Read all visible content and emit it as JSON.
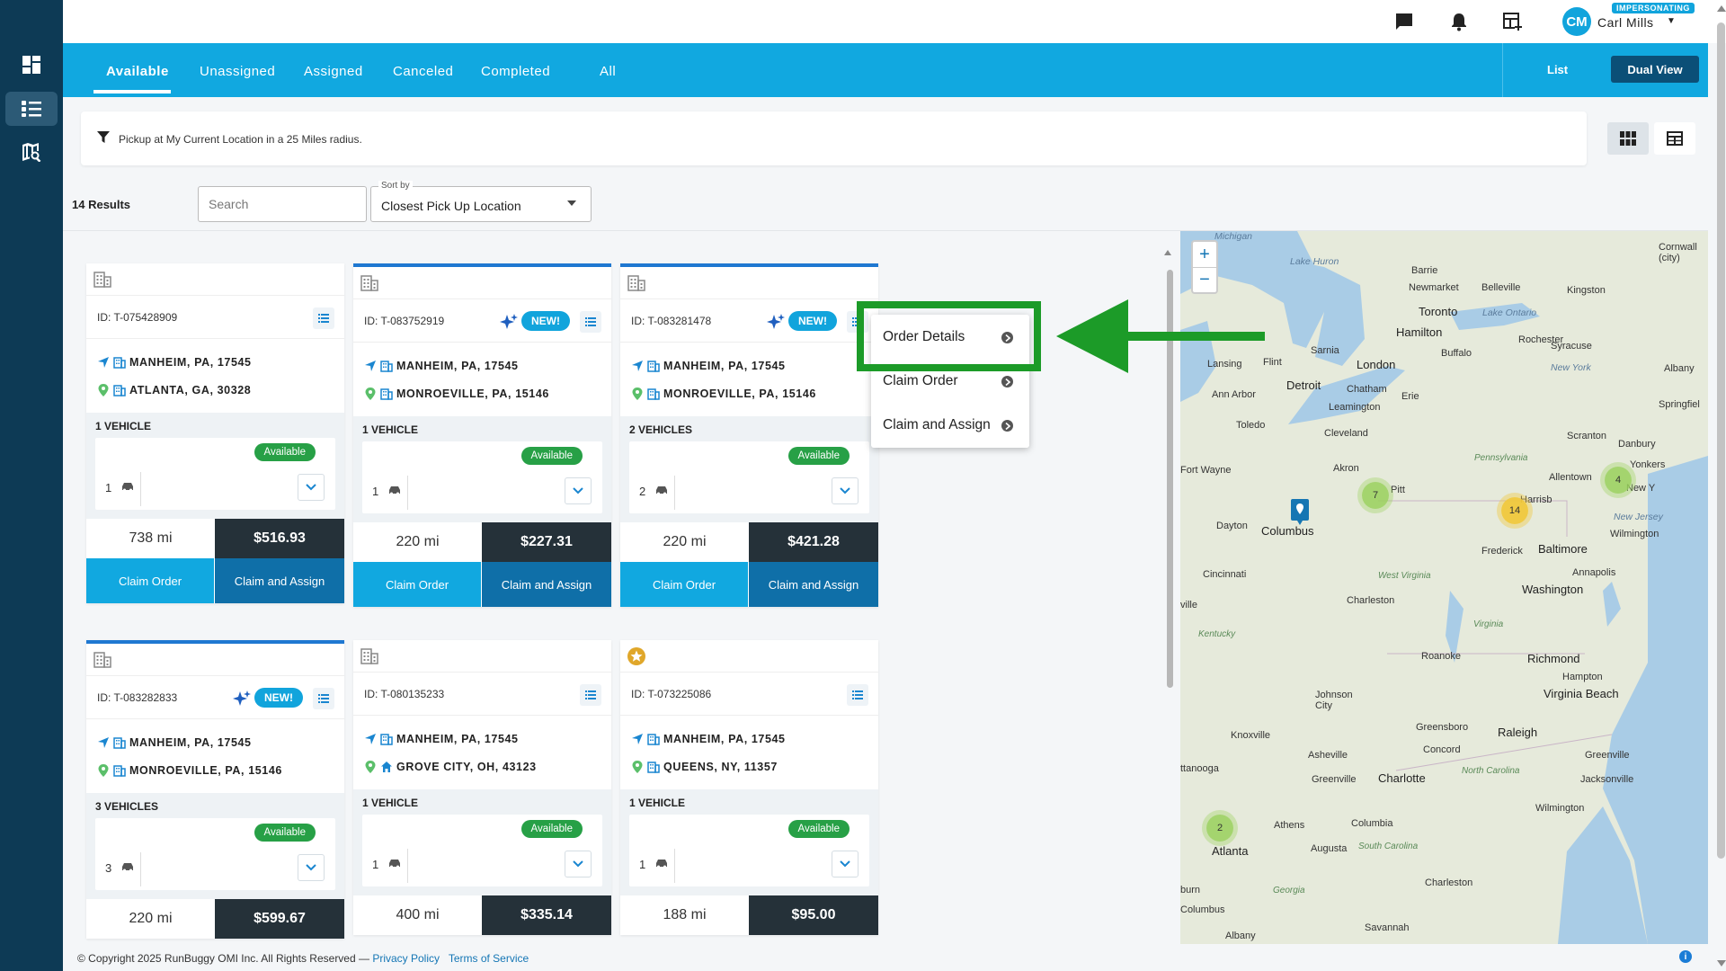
{
  "header": {
    "avatar_initials": "CM",
    "impersonating_label": "IMPERSONATING",
    "user_name": "Carl Mills"
  },
  "tabs": [
    {
      "label": "Available",
      "active": true
    },
    {
      "label": "Unassigned"
    },
    {
      "label": "Assigned"
    },
    {
      "label": "Canceled"
    },
    {
      "label": "Completed"
    },
    {
      "label": "All"
    }
  ],
  "view_toggle": {
    "list_label": "List",
    "dual_label": "Dual View"
  },
  "filter": {
    "text": "Pickup at My Current Location in a 25 Miles radius."
  },
  "toolbar": {
    "results": "14 Results",
    "search_placeholder": "Search",
    "sort_label": "Sort by",
    "sort_value": "Closest Pick Up Location"
  },
  "orders": [
    {
      "id": "ID: T-075428909",
      "new": false,
      "origin": "MANHEIM, PA, 17545",
      "destination": "ATLANTA, GA, 30328",
      "vehicles_label": "1 VEHICLE",
      "count": "1",
      "status": "Available",
      "miles": "738 mi",
      "price": "$516.93",
      "claim": "Claim Order",
      "assign": "Claim and Assign"
    },
    {
      "id": "ID: T-083752919",
      "new": true,
      "new_label": "NEW!",
      "origin": "MANHEIM, PA, 17545",
      "destination": "MONROEVILLE, PA, 15146",
      "vehicles_label": "1 VEHICLE",
      "count": "1",
      "status": "Available",
      "miles": "220 mi",
      "price": "$227.31",
      "claim": "Claim Order",
      "assign": "Claim and Assign"
    },
    {
      "id": "ID: T-083281478",
      "new": true,
      "new_label": "NEW!",
      "origin": "MANHEIM, PA, 17545",
      "destination": "MONROEVILLE, PA, 15146",
      "vehicles_label": "2 VEHICLES",
      "count": "2",
      "status": "Available",
      "miles": "220 mi",
      "price": "$421.28",
      "claim": "Claim Order",
      "assign": "Claim and Assign"
    },
    {
      "id": "ID: T-083282833",
      "new": true,
      "new_label": "NEW!",
      "origin": "MANHEIM, PA, 17545",
      "destination": "MONROEVILLE, PA, 15146",
      "vehicles_label": "3 VEHICLES",
      "count": "3",
      "status": "Available",
      "miles": "220 mi",
      "price": "$599.67"
    },
    {
      "id": "ID: T-080135233",
      "new": false,
      "origin": "MANHEIM, PA, 17545",
      "destination": "GROVE CITY, OH, 43123",
      "vehicles_label": "1 VEHICLE",
      "count": "1",
      "status": "Available",
      "miles": "400 mi",
      "price": "$335.14"
    },
    {
      "id": "ID: T-073225086",
      "new": false,
      "origin": "MANHEIM, PA, 17545",
      "destination": "QUEENS, NY, 11357",
      "vehicles_label": "1 VEHICLE",
      "count": "1",
      "status": "Available",
      "miles": "188 mi",
      "price": "$95.00"
    }
  ],
  "context_menu": [
    "Order Details",
    "Claim Order",
    "Claim and Assign"
  ],
  "map": {
    "clusters": [
      {
        "label": "7",
        "color": "green"
      },
      {
        "label": "14",
        "color": "yellow"
      },
      {
        "label": "4",
        "color": "green"
      },
      {
        "label": "2",
        "color": "green"
      }
    ],
    "labels": [
      "Michigan",
      "Lake Huron",
      "Cornwall (city)",
      "Barrie",
      "Newmarket",
      "Belleville",
      "Kingston",
      "Toronto",
      "Lake Ontario",
      "Hamilton",
      "Rochester",
      "Syracuse",
      "Buffalo",
      "New York",
      "Albany",
      "Sarnia",
      "London",
      "Lansing",
      "Flint",
      "Detroit",
      "Chatham",
      "Ann Arbor",
      "Erie",
      "Leamington",
      "Springfiel",
      "Toledo",
      "Cleveland",
      "Scranton",
      "Danbury",
      "Pennsylvania",
      "Akron",
      "Allentown",
      "Yonkers",
      "Fort Wayne",
      "Pitt",
      "Harrisb",
      "New Y",
      "New Jersey",
      "Dayton",
      "Columbus",
      "Wilmington",
      "Frederick",
      "Baltimore",
      "Cincinnati",
      "Annapolis",
      "West Virginia",
      "Washington",
      "Charleston",
      "ville",
      "Kentucky",
      "Virginia",
      "Roanoke",
      "Richmond",
      "Hampton",
      "Virginia Beach",
      "Johnson City",
      "Knoxville",
      "Greensboro",
      "Raleigh",
      "Asheville",
      "Concord",
      "Greenville",
      "ttanooga",
      "Greenville",
      "Charlotte",
      "North Carolina",
      "Jacksonville",
      "Wilmington",
      "Athens",
      "Columbia",
      "Atlanta",
      "Augusta",
      "South Carolina",
      "Charleston",
      "burn",
      "Georgia",
      "Columbus",
      "Savannah",
      "Albany"
    ]
  },
  "footer": {
    "copyright": "© Copyright 2025 RunBuggy OMI Inc. All Rights Reserved — ",
    "privacy": "Privacy Policy",
    "terms": "Terms of Service"
  },
  "colors": {
    "accent": "#11a8e0",
    "dark_accent": "#0f6fa8",
    "rail": "#0d3a55",
    "available": "#27a046",
    "highlight": "#1c9b28"
  }
}
